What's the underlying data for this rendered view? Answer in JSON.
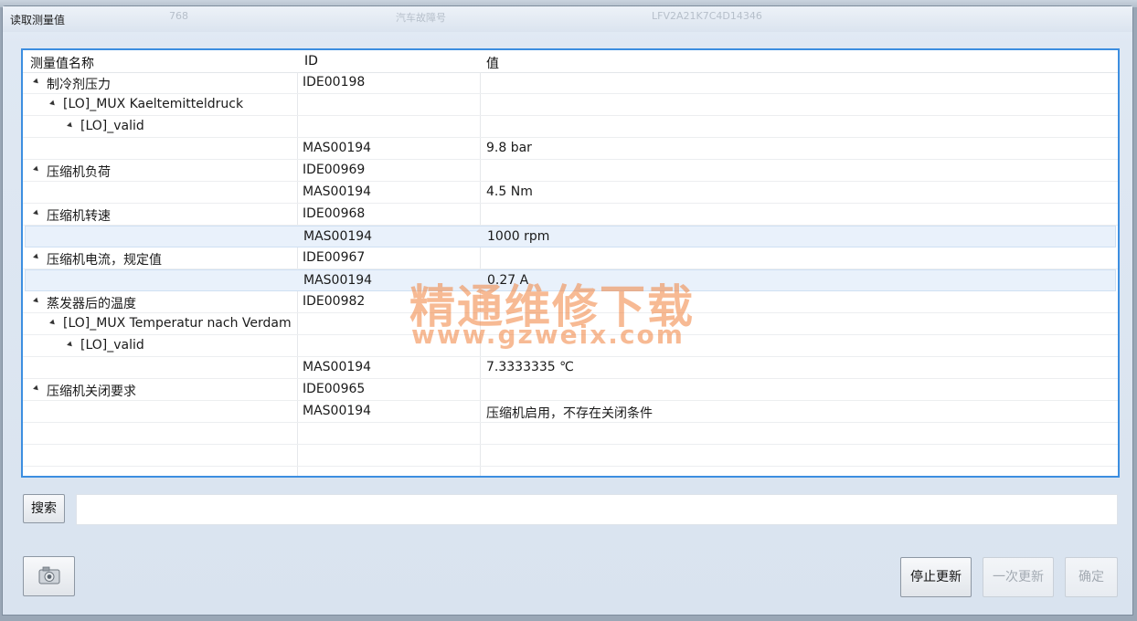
{
  "window": {
    "title": "读取测量值",
    "bg_tabs": [
      "768",
      "汽车故障号",
      "LFV2A21K7C4D14346"
    ]
  },
  "table": {
    "headers": [
      "测量值名称",
      "ID",
      "值"
    ],
    "rows": [
      {
        "name": "制冷剂压力",
        "id": "IDE00198",
        "value": ""
      },
      {
        "name": "[LO]_MUX Kaeltemitteldruck",
        "id": "",
        "value": ""
      },
      {
        "name": "[LO]_valid",
        "id": "",
        "value": ""
      },
      {
        "name": "",
        "id": "MAS00194",
        "value": "9.8 bar"
      },
      {
        "name": "压缩机负荷",
        "id": "IDE00969",
        "value": ""
      },
      {
        "name": "",
        "id": "MAS00194",
        "value": "4.5 Nm"
      },
      {
        "name": "压缩机转速",
        "id": "IDE00968",
        "value": ""
      },
      {
        "name": "",
        "id": "MAS00194",
        "value": "1000 rpm"
      },
      {
        "name": "压缩机电流，规定值",
        "id": "IDE00967",
        "value": ""
      },
      {
        "name": "",
        "id": "MAS00194",
        "value": "0.27 A"
      },
      {
        "name": "蒸发器后的温度",
        "id": "IDE00982",
        "value": ""
      },
      {
        "name": "[LO]_MUX Temperatur nach Verdam",
        "id": "",
        "value": ""
      },
      {
        "name": "[LO]_valid",
        "id": "",
        "value": ""
      },
      {
        "name": "",
        "id": "MAS00194",
        "value": "7.3333335 ℃"
      },
      {
        "name": "压缩机关闭要求",
        "id": "IDE00965",
        "value": ""
      },
      {
        "name": "",
        "id": "MAS00194",
        "value": "压缩机启用，不存在关闭条件"
      }
    ]
  },
  "search": {
    "button_label": "搜索",
    "value": ""
  },
  "buttons": {
    "stop_update": "停止更新",
    "single_update": "一次更新",
    "ok": "确定"
  },
  "watermark": {
    "line1": "精通维修下载",
    "line2": "www.gzweix.com"
  },
  "colors": {
    "accent": "#3c8ee0",
    "selected_row": "#e9f1fb",
    "watermark": "#f08240"
  }
}
